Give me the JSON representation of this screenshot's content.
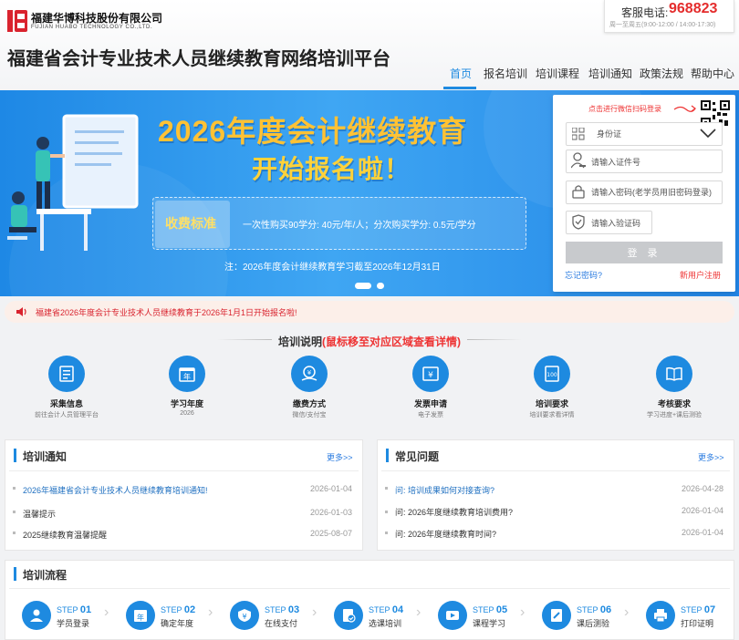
{
  "header": {
    "company_name_cn": "福建华博科技股份有限公司",
    "company_name_en": "FUJIAN HUABO TECHNOLOGY CO.,LTD.",
    "site_title": "福建省会计专业技术人员继续教育网络培训平台",
    "phone_label": "客服电话:",
    "phone_number": "968823",
    "phone_hours": "周一至周五(9:00-12:00 / 14:00-17:30)"
  },
  "nav": {
    "items": [
      {
        "label": "首页",
        "active": true
      },
      {
        "label": "报名培训",
        "active": false
      },
      {
        "label": "培训课程",
        "active": false
      },
      {
        "label": "培训通知",
        "active": false
      },
      {
        "label": "政策法规",
        "active": false
      },
      {
        "label": "帮助中心",
        "active": false
      }
    ]
  },
  "banner": {
    "title_line1": "2026年度会计继续教育",
    "title_line2": "开始报名啦！",
    "fee_label": "收费标准",
    "fee_text": "一次性购买90学分: 40元/年/人；分次购买学分: 0.5元/学分",
    "note": "注：2026年度会计继续教育学习截至2026年12月31日"
  },
  "login": {
    "qr_hint": "点击进行微信扫码登录",
    "id_type": "身份证",
    "id_placeholder": "请输入证件号",
    "password_placeholder": "请输入密码(老学员用旧密码登录)",
    "captcha_placeholder": "请输入验证码",
    "login_button": "登 录",
    "forgot_link": "忘记密码?",
    "register_link": "新用户注册"
  },
  "notice": {
    "text": "福建省2026年度会计专业技术人员继续教育于2026年1月1日开始报名啦!"
  },
  "training_info": {
    "title": "培训说明",
    "title_highlight": "(鼠标移至对应区域查看详情)",
    "items": [
      {
        "title": "采集信息",
        "subtitle": "前往会计人员管理平台",
        "icon": "form-icon"
      },
      {
        "title": "学习年度",
        "subtitle": "2026",
        "icon": "calendar-year-icon"
      },
      {
        "title": "缴费方式",
        "subtitle": "微信/支付宝",
        "icon": "payment-icon"
      },
      {
        "title": "发票申请",
        "subtitle": "电子发票",
        "icon": "invoice-icon"
      },
      {
        "title": "培训要求",
        "subtitle": "培训要求看详情",
        "icon": "certificate-icon"
      },
      {
        "title": "考核要求",
        "subtitle": "学习进度+课后测验",
        "icon": "book-icon"
      }
    ]
  },
  "training_notice": {
    "title": "培训通知",
    "more": "更多>>",
    "items": [
      {
        "text": "2026年福建省会计专业技术人员继续教育培训通知!",
        "date": "2026-01-04",
        "highlight": true
      },
      {
        "text": "温馨提示",
        "date": "2026-01-03",
        "highlight": false
      },
      {
        "text": "2025继续教育温馨提醒",
        "date": "2025-08-07",
        "highlight": false
      }
    ]
  },
  "faq": {
    "title": "常见问题",
    "more": "更多>>",
    "items": [
      {
        "prefix": "问:",
        "text": "培训成果如何对接查询?",
        "date": "2026-04-28",
        "highlight": true
      },
      {
        "prefix": "问:",
        "text": "2026年度继续教育培训费用?",
        "date": "2026-01-04",
        "highlight": false
      },
      {
        "prefix": "问:",
        "text": "2026年度继续教育时间?",
        "date": "2026-01-04",
        "highlight": false
      }
    ]
  },
  "process": {
    "title": "培训流程",
    "steps": [
      {
        "step": "STEP",
        "num": "01",
        "label": "学员登录",
        "icon": "user-icon"
      },
      {
        "step": "STEP",
        "num": "02",
        "label": "确定年度",
        "icon": "year-icon"
      },
      {
        "step": "STEP",
        "num": "03",
        "label": "在线支付",
        "icon": "pay-icon"
      },
      {
        "step": "STEP",
        "num": "04",
        "label": "选课培训",
        "icon": "course-select-icon"
      },
      {
        "step": "STEP",
        "num": "05",
        "label": "课程学习",
        "icon": "video-icon"
      },
      {
        "step": "STEP",
        "num": "06",
        "label": "课后测验",
        "icon": "test-icon"
      },
      {
        "step": "STEP",
        "num": "07",
        "label": "打印证明",
        "icon": "printer-icon"
      }
    ]
  },
  "colors": {
    "primary": "#1e8ae0",
    "accent_red": "#e42c2c",
    "banner_yellow": "#ffc234"
  }
}
